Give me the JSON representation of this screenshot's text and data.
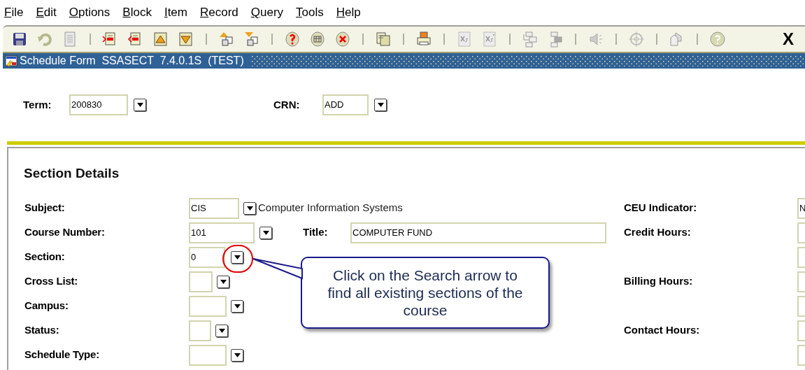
{
  "menu": [
    "File",
    "Edit",
    "Options",
    "Block",
    "Item",
    "Record",
    "Query",
    "Tools",
    "Help"
  ],
  "toolbar": [
    [
      {
        "kind": "save"
      },
      {
        "kind": "undo"
      },
      {
        "kind": "page"
      }
    ],
    [
      {
        "kind": "insert"
      },
      {
        "kind": "remove"
      },
      {
        "kind": "first"
      },
      {
        "kind": "last"
      }
    ],
    [
      {
        "kind": "upcopy"
      },
      {
        "kind": "downcopy"
      }
    ],
    [
      {
        "kind": "helpdb"
      },
      {
        "kind": "griddb"
      },
      {
        "kind": "deletedb"
      }
    ],
    [
      {
        "kind": "copydoc"
      }
    ],
    [
      {
        "kind": "print"
      }
    ],
    [
      {
        "kind": "xs"
      },
      {
        "kind": "xs2"
      }
    ],
    [
      {
        "kind": "tree"
      },
      {
        "kind": "tree2"
      }
    ],
    [
      {
        "kind": "speaker"
      }
    ],
    [
      {
        "kind": "target"
      }
    ],
    [
      {
        "kind": "house"
      }
    ],
    [
      {
        "kind": "help"
      }
    ]
  ],
  "exit_label": "X",
  "window": {
    "title": "Schedule Form  SSASECT  7.4.0.1S  (TEST)"
  },
  "key_block": [
    {
      "label": "Term:",
      "value": "200830"
    },
    {
      "label": "CRN:",
      "value": "ADD"
    }
  ],
  "section": {
    "title": "Section Details",
    "rows": [
      {
        "label": "Subject:",
        "value": "CIS",
        "description": "Computer Information Systems"
      },
      {
        "label": "Course Number:",
        "value": "101",
        "title_label": "Title:",
        "title_value": "COMPUTER FUND"
      },
      {
        "label": "Section:",
        "value": "0"
      },
      {
        "label": "Cross List:"
      },
      {
        "label": "Campus:"
      },
      {
        "label": "Status:"
      },
      {
        "label": "Schedule Type:"
      }
    ],
    "right_rows": [
      {
        "kind": "labeled",
        "label": "CEU Indicator:",
        "value": "N"
      },
      {
        "kind": "labeled",
        "label": "Credit Hours:"
      },
      {
        "kind": "blank"
      },
      {
        "kind": "labeled",
        "label": "Billing Hours:"
      },
      {
        "kind": "blank"
      },
      {
        "kind": "labeled",
        "label": "Contact Hours:"
      },
      {
        "kind": "blank"
      }
    ]
  },
  "callout": {
    "text": "Click on the Search arrow to find all existing sections of the course"
  }
}
